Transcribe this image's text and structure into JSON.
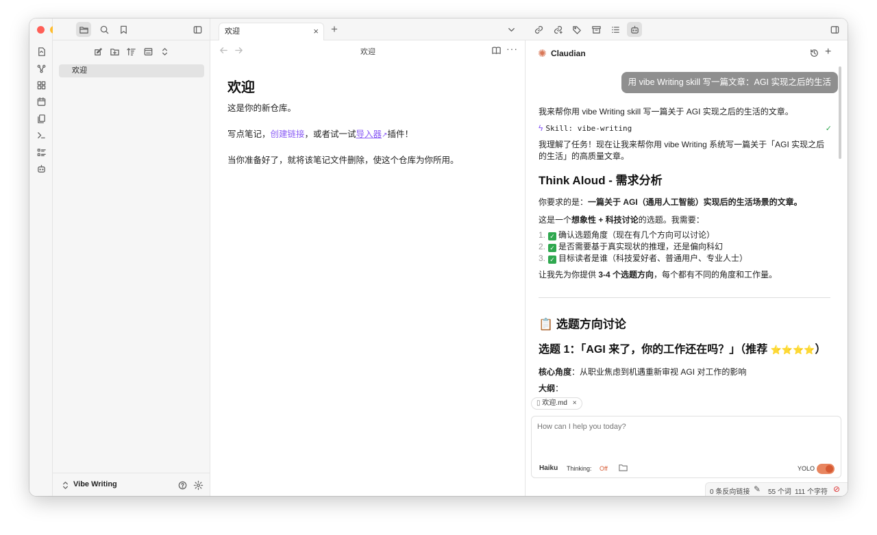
{
  "colors": {
    "accent": "#8a5cf5",
    "claudian_brand": "#d97757",
    "yolo_toggle": "#e8855f",
    "user_bubble": "#8f8f8f",
    "traffic_red": "#ff5f57",
    "traffic_yellow": "#febc2e",
    "traffic_green": "#28c840"
  },
  "sidebar": {
    "files": [
      "欢迎"
    ],
    "vault_name": "Vibe Writing"
  },
  "editor": {
    "tab_title": "欢迎",
    "header_title": "欢迎",
    "doc": {
      "title": "欢迎",
      "p1": "这是你的新仓库。",
      "p2_a": "写点笔记，",
      "p2_link1": "创建链接",
      "p2_b": "，或者试一试",
      "p2_link2": "导入器",
      "p2_c": "插件！",
      "p3": "当你准备好了，就将该笔记文件删除，使这个仓库为你所用。"
    }
  },
  "claudian": {
    "title": "Claudian",
    "user_message": "用 vibe Writing skill 写一篇文章：AGI 实现之后的生活",
    "resp_intro": "我来帮你用 vibe Writing skill 写一篇关于 AGI 实现之后的生活的文章。",
    "skill_label": "Skill: vibe-writing",
    "resp_p2": "我理解了任务！现在让我来帮你用 vibe Writing 系统写一篇关于「AGI 实现之后的生活」的高质量文章。",
    "h_think": "Think Aloud - 需求分析",
    "req_a": "你要求的是：",
    "req_b": "一篇关于 AGI（通用人工智能）实现后的生活场景的文章。",
    "topic_a": "这是一个",
    "topic_b": "想象性 + 科技讨论",
    "topic_c": "的选题。我需要：",
    "list": [
      {
        "num": "1.",
        "text": "确认选题角度（现在有几个方向可以讨论）"
      },
      {
        "num": "2.",
        "text": "是否需要基于真实现状的推理，还是偏向科幻"
      },
      {
        "num": "3.",
        "text": "目标读者是谁（科技爱好者、普通用户、专业人士）"
      }
    ],
    "offer_a": "让我先为你提供 ",
    "offer_b": "3-4 个选题方向",
    "offer_c": "，每个都有不同的角度和工作量。",
    "h_topics": "📋 选题方向讨论",
    "h_topic1": "选题 1：「AGI 来了，你的工作还在吗？」（推荐 ",
    "h_topic1_stars": "⭐⭐⭐⭐",
    "h_topic1_end": "）",
    "core_label": "核心角度",
    "core_text": "：从职业焦虑到机遇重新审视 AGI 对工作的影响",
    "outline_label": "大纲",
    "outline_colon": "：",
    "attachment": "欢迎.md",
    "input_placeholder": "How can I help you today?",
    "model": "Haiku",
    "thinking_label": "Thinking:",
    "thinking_value": "Off",
    "yolo_label": "YOLO",
    "yolo_on": true
  },
  "status_bar": {
    "backlinks": "0 条反向链接",
    "words": "55 个词",
    "chars": "111 个字符"
  }
}
